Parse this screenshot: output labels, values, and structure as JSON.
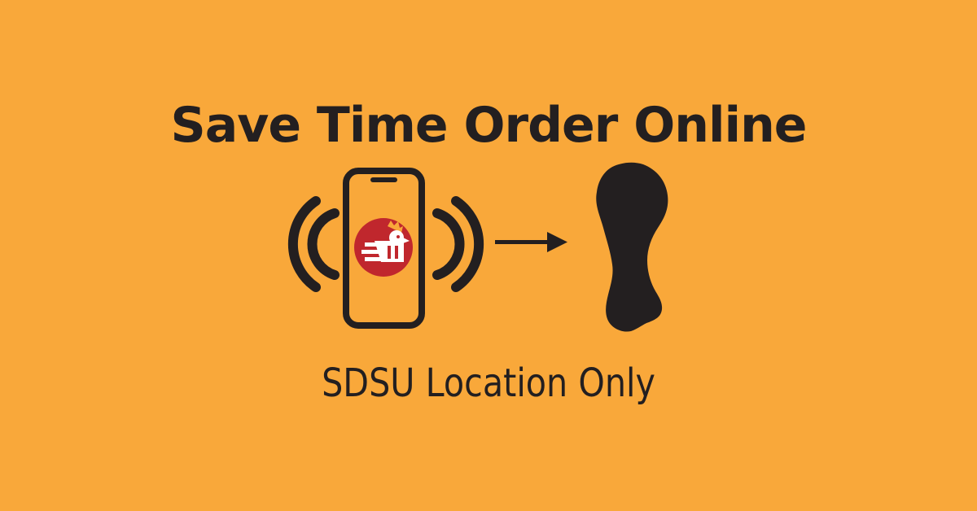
{
  "headline": "Save Time Order Online",
  "subline": "SDSU Location Only",
  "colors": {
    "background": "#F9A83A",
    "ink": "#231F20",
    "logo_red": "#C0272D",
    "logo_white": "#FFFFFF",
    "comb_orange": "#F9A83A"
  },
  "icons": {
    "phone": "smartphone-icon",
    "signal": "vibration-waves-icon",
    "logo": "restaurant-logo",
    "arrow": "arrow-right-icon",
    "food": "chicken-drumstick-icon"
  }
}
